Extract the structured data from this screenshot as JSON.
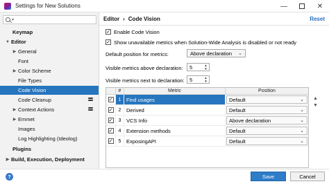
{
  "window": {
    "title": "Settings for New Solutions"
  },
  "sidebar": {
    "search_placeholder": "",
    "items": [
      {
        "label": "Keymap"
      },
      {
        "label": "Editor"
      },
      {
        "label": "General"
      },
      {
        "label": "Font"
      },
      {
        "label": "Color Scheme"
      },
      {
        "label": "File Types"
      },
      {
        "label": "Code Vision"
      },
      {
        "label": "Code Cleanup"
      },
      {
        "label": "Context Actions"
      },
      {
        "label": "Emmet"
      },
      {
        "label": "Images"
      },
      {
        "label": "Log Highlighting (Ideolog)"
      },
      {
        "label": "Plugins"
      },
      {
        "label": "Build, Execution, Deployment"
      }
    ]
  },
  "header": {
    "breadcrumb": [
      "Editor",
      "Code Vision"
    ],
    "separator": "›",
    "reset_label": "Reset"
  },
  "options": {
    "enable_label": "Enable Code Vision",
    "enable_checked": true,
    "show_unavailable_label": "Show unavailable metrics when Solution-Wide Analysis is disabled or not ready",
    "show_unavailable_checked": true,
    "position_label": "Default position for metrics:",
    "position_value": "Above declaration",
    "above_label": "Visible metrics above declaration:",
    "above_value": "5",
    "next_label": "Visible metrics next to declaration:",
    "next_value": "5"
  },
  "table": {
    "headers": {
      "num": "#",
      "metric": "Metric",
      "position": "Position"
    },
    "rows": [
      {
        "num": "1",
        "metric": "Find usages",
        "position": "Default",
        "checked": true,
        "selected": true
      },
      {
        "num": "2",
        "metric": "Derived",
        "position": "Default",
        "checked": true,
        "selected": false
      },
      {
        "num": "3",
        "metric": "VCS Info",
        "position": "Above declaration",
        "checked": true,
        "selected": false
      },
      {
        "num": "4",
        "metric": "Extension methods",
        "position": "Default",
        "checked": true,
        "selected": false
      },
      {
        "num": "5",
        "metric": "ExposingAPI",
        "position": "Default",
        "checked": true,
        "selected": false
      }
    ]
  },
  "footer": {
    "help_label": "?",
    "save_label": "Save",
    "cancel_label": "Cancel"
  },
  "colors": {
    "accent": "#2675bf",
    "save_button": "#2f7cc8"
  }
}
